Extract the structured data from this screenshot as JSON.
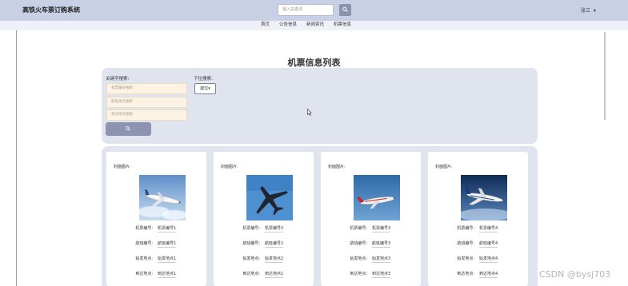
{
  "header": {
    "app_title": "高铁火车票订购系统",
    "search_placeholder": "输入关键词",
    "user_label": "张三"
  },
  "nav": {
    "items": [
      "首页",
      "公告信息",
      "新闻资讯",
      "机票信息"
    ]
  },
  "main": {
    "title": "机票信息列表",
    "keyword_search_label": "关键字搜索:",
    "keyword_inputs": [
      "机票编号搜索",
      "航班地点搜索",
      "到达地点搜索"
    ],
    "dropdown_search_label": "下拉搜索:",
    "dropdown_value": "座位"
  },
  "cards": [
    {
      "image_label": "封面图片:",
      "ticket_no_key": "机票编号:",
      "ticket_no": "机票编号1",
      "flight_no_key": "航班编号:",
      "flight_no": "航班编号1",
      "depart_key": "始发地点:",
      "depart": "始发地点1",
      "arrive_key": "到达地点:",
      "arrive": "到达地点1"
    },
    {
      "image_label": "封面图片:",
      "ticket_no_key": "机票编号:",
      "ticket_no": "机票编号2",
      "flight_no_key": "航班编号:",
      "flight_no": "航班编号2",
      "depart_key": "始发地点:",
      "depart": "始发地点2",
      "arrive_key": "到达地点:",
      "arrive": "到达地点1"
    },
    {
      "image_label": "封面图片:",
      "ticket_no_key": "机票编号:",
      "ticket_no": "机票编号3",
      "flight_no_key": "航班编号:",
      "flight_no": "航班编号3",
      "depart_key": "始发地点:",
      "depart": "始发地点3",
      "arrive_key": "到达地点:",
      "arrive": "到达地点3"
    },
    {
      "image_label": "封面图片:",
      "ticket_no_key": "机票编号:",
      "ticket_no": "机票编号4",
      "flight_no_key": "航班编号:",
      "flight_no": "航班编号4",
      "depart_key": "始发地点:",
      "depart": "始发地点4",
      "arrive_key": "到达地点:",
      "arrive": "到达地点4"
    }
  ],
  "icons": {
    "search": "search-icon",
    "caret": "caret-down-icon",
    "cursor": "mouse-cursor-icon"
  },
  "colors": {
    "topbar": "#c8d0e6",
    "panel": "#dfe4ef",
    "button": "#8d93b1",
    "input_bg": "#fcf3e2"
  },
  "watermark": "CSDN @bysj703"
}
